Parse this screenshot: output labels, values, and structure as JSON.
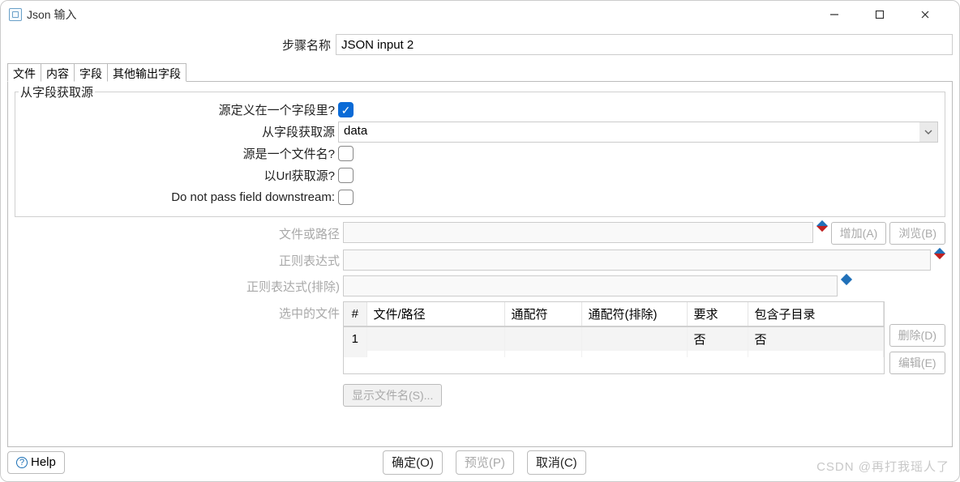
{
  "title": "Json 输入",
  "step": {
    "label": "步骤名称",
    "value": "JSON input 2"
  },
  "tabs": [
    "文件",
    "内容",
    "字段",
    "其他输出字段"
  ],
  "fieldset": {
    "legend": "从字段获取源",
    "rows": {
      "source_in_field": {
        "label": "源定义在一个字段里?",
        "checked": true
      },
      "from_field": {
        "label": "从字段获取源",
        "value": "data"
      },
      "is_filename": {
        "label": "源是一个文件名?",
        "checked": false
      },
      "from_url": {
        "label": "以Url获取源?",
        "checked": false
      },
      "no_pass": {
        "label": "Do not pass field downstream:",
        "checked": false
      }
    }
  },
  "file_section": {
    "file_or_path": {
      "label": "文件或路径",
      "value": ""
    },
    "regex": {
      "label": "正则表达式",
      "value": ""
    },
    "regex_ex": {
      "label": "正则表达式(排除)",
      "value": ""
    },
    "selected": {
      "label": "选中的文件"
    },
    "buttons": {
      "add": "增加(A)",
      "browse": "浏览(B)",
      "delete": "删除(D)",
      "edit": "编辑(E)",
      "show": "显示文件名(S)..."
    }
  },
  "grid": {
    "headers": [
      "#",
      "文件/路径",
      "通配符",
      "通配符(排除)",
      "要求",
      "包含子目录"
    ],
    "rows": [
      {
        "n": "1",
        "path": "",
        "wc": "",
        "wcex": "",
        "req": "否",
        "subdir": "否"
      }
    ]
  },
  "footer": {
    "help": "Help",
    "ok": "确定(O)",
    "preview": "预览(P)",
    "cancel": "取消(C)"
  },
  "watermark": "CSDN @再打我瑶人了"
}
